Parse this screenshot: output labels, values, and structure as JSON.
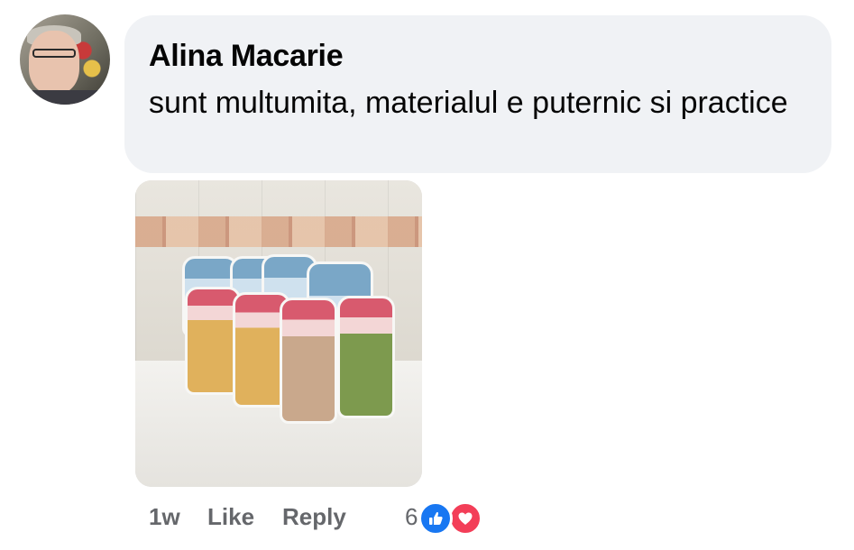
{
  "comment": {
    "author": "Alina Macarie",
    "text": "sunt multumita, materialul e puternic si practice",
    "attachment": "photo-of-storage-bags",
    "footer": {
      "time": "1w",
      "like_label": "Like",
      "reply_label": "Reply",
      "reaction_count": "6",
      "reactions": [
        "like-icon",
        "love-icon"
      ]
    }
  },
  "colors": {
    "bubble_bg": "#f0f2f5",
    "text": "#050505",
    "meta_text": "#65676b",
    "like_blue": "#1877f2",
    "love_red": "#f33e58"
  }
}
